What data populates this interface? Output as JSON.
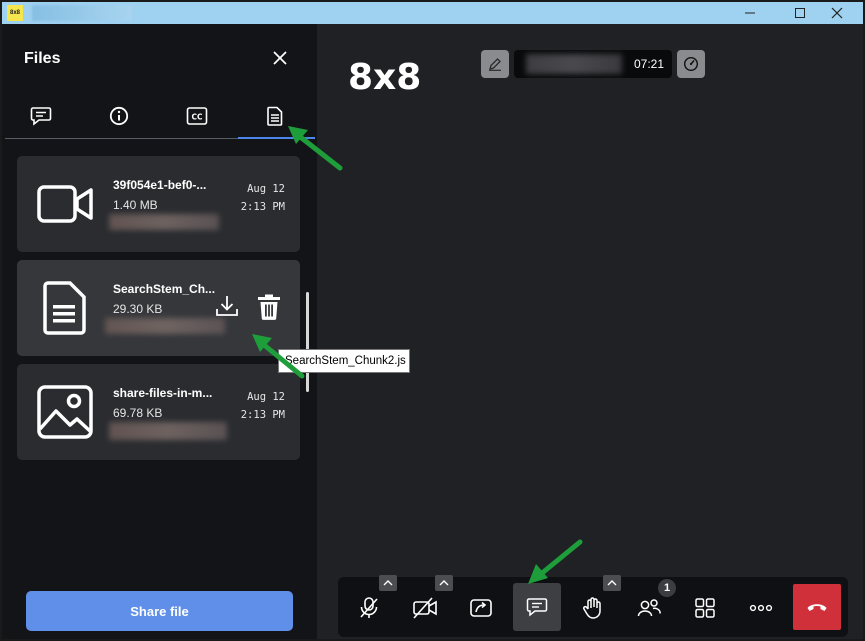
{
  "titlebar": {
    "logo_text": "8x8",
    "controls": [
      "minimize",
      "maximize",
      "close"
    ]
  },
  "sidebar": {
    "title": "Files",
    "tabs": [
      {
        "icon": "chat-icon"
      },
      {
        "icon": "info-icon"
      },
      {
        "icon": "captions-icon"
      },
      {
        "icon": "document-icon",
        "active": true
      }
    ],
    "files": [
      {
        "name": "39f054e1-bef0-...",
        "size": "1.40 MB",
        "date": "Aug 12",
        "time": "2:13 PM",
        "icon": "video-icon"
      },
      {
        "name": "SearchStem_Ch...",
        "size": "29.30 KB",
        "icon": "document-icon",
        "actions": [
          "download",
          "delete"
        ]
      },
      {
        "name": "share-files-in-m...",
        "size": "69.78 KB",
        "date": "Aug 12",
        "time": "2:13 PM",
        "icon": "image-icon"
      }
    ],
    "tooltip": "SearchStem_Chunk2.js",
    "share_button": "Share file"
  },
  "main": {
    "brand": "8x8",
    "timer": "07:21"
  },
  "toolbar": {
    "participant_count": "1",
    "buttons": [
      "microphone-muted",
      "camera-off",
      "share-screen",
      "chat",
      "raise-hand",
      "participants",
      "tile-view",
      "more",
      "hang-up"
    ]
  },
  "colors": {
    "accent": "#4b86e8",
    "share_button": "#5f8fe8",
    "hangup": "#d0303a",
    "annotation_arrow": "#1e9e3a"
  }
}
